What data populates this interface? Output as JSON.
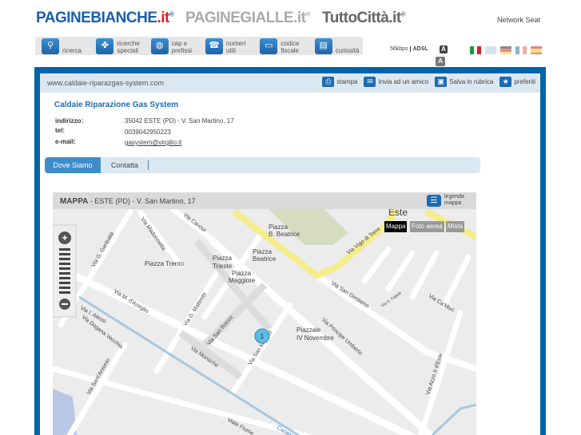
{
  "header": {
    "logos": {
      "paginebianche": "PAGINEBIANCHE",
      "paginebianche_tld": ".it",
      "paginegialle": "PAGINEGIALLE.it",
      "tuttocitta": "TuttoCittà.it"
    },
    "network": "Network Seat"
  },
  "nav": [
    {
      "label": "ricerca",
      "icon": "search-icon"
    },
    {
      "label": "ricerche speciali",
      "icon": "clover-icon"
    },
    {
      "label": "cap e prefissi",
      "icon": "globe-icon"
    },
    {
      "label": "numeri utili",
      "icon": "phone-icon"
    },
    {
      "label": "codice fiscale",
      "icon": "card-icon"
    },
    {
      "label": "curiosità",
      "icon": "book-icon"
    }
  ],
  "speed": {
    "kbps": "56kbps",
    "adsl": "ADSL",
    "font_large": "A",
    "font_small": "A"
  },
  "languages": [
    "italiano",
    "english",
    "deutsch",
    "français",
    "español"
  ],
  "url": "www.caldaie-riparazgas-system.com",
  "actions": [
    {
      "label": "stampa",
      "icon": "print-icon"
    },
    {
      "label": "Invia ad un amico",
      "icon": "mail-icon"
    },
    {
      "label": "Salva in rubrica",
      "icon": "save-icon"
    },
    {
      "label": "preferiti",
      "icon": "star-icon"
    }
  ],
  "business": {
    "name": "Caldaie Riparazione Gas System",
    "address_label": "indirizzo:",
    "address": "35042 ESTE (PD) - V. San Martino, 17",
    "tel_label": "tel:",
    "tel": "0039042950223",
    "email_label": "e-mail:",
    "email": "gasystem@virgilio.it"
  },
  "tabs": [
    "Dove Siamo",
    "Contatta"
  ],
  "map": {
    "title": "MAPPA",
    "subtitle": "- ESTE (PD) - V. San Martino, 17",
    "legend": "legenda mappa",
    "types": [
      "Mappa",
      "Foto aerea",
      "Mista"
    ],
    "marker": "1",
    "labels": [
      "Este",
      "Piazza",
      "B. Beatrice",
      "Piazza",
      "Beatrice",
      "Piazza",
      "Trieste",
      "Piazza",
      "Maggiore",
      "Piazza Trento",
      "Piazzale",
      "IV Novembre",
      "Via Cavour",
      "Via Madonnetta",
      "Via G. Garibaldi",
      "Via M. d'Azeglio",
      "Via G. Matteotti",
      "Via San Rocco",
      "Via San Martino",
      "Via Monache",
      "Via Principe Umberto",
      "Via San Girolamo",
      "Via Ca'Mori",
      "Via Vigo di Torre",
      "Via I. Alessi",
      "Via Dogana Vecchia",
      "Via Sant'Antonio",
      "Via Azzo II d'Este",
      "Viale Fiume",
      "Canale",
      "Via G. Fattelli"
    ]
  }
}
